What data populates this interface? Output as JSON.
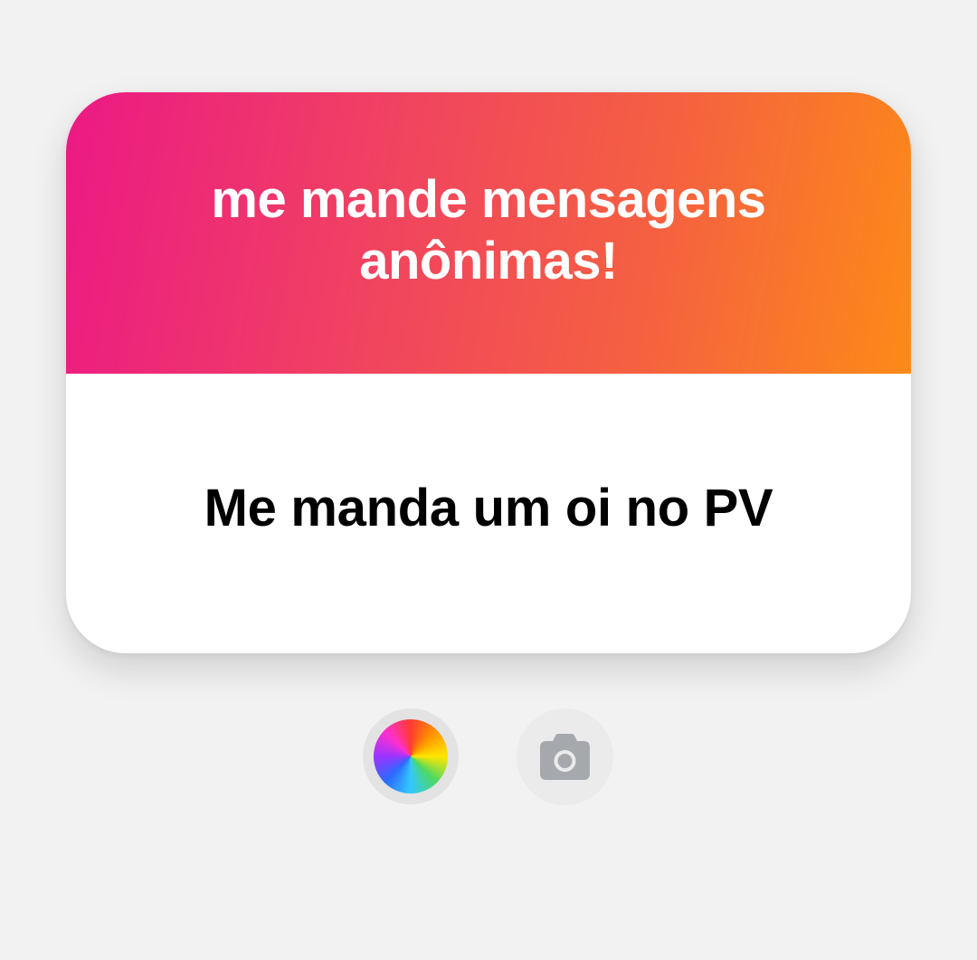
{
  "sticker": {
    "title": "me mande mensagens anônimas!",
    "answer": "Me manda um oi no PV"
  },
  "controls": {
    "color_button_icon": "color-wheel-icon",
    "camera_button_icon": "camera-icon"
  },
  "colors": {
    "background": "#f2f2f2",
    "gradient_start": "#ec1985",
    "gradient_end": "#fd8a18",
    "card": "#ffffff",
    "camera_icon": "#a5a9ae"
  }
}
